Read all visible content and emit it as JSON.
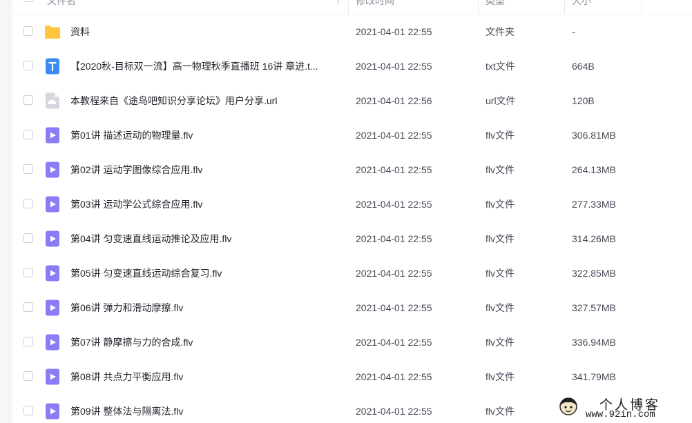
{
  "header": {
    "name": "文件名",
    "modified": "修改时间",
    "type": "类型",
    "size": "大小"
  },
  "icons": {
    "folder": "folder-icon",
    "txt": "text-file-icon",
    "url": "link-file-icon",
    "flv": "video-file-icon"
  },
  "colors": {
    "folder": "#ffc53d",
    "txt": "#3b8bf5",
    "url": "#d4d7dd",
    "flv": "#8b7cf6",
    "sort_arrow": "#3b7df0"
  },
  "rows": [
    {
      "icon": "folder",
      "name": "资料",
      "modified": "2021-04-01 22:55",
      "type": "文件夹",
      "size": "-"
    },
    {
      "icon": "txt",
      "name": "【2020秋-目标双一流】高一物理秋季直播班 16讲 章进.t...",
      "modified": "2021-04-01 22:55",
      "type": "txt文件",
      "size": "664B"
    },
    {
      "icon": "url",
      "name": "本教程来自《途鸟吧知识分享论坛》用户分享.url",
      "modified": "2021-04-01 22:56",
      "type": "url文件",
      "size": "120B"
    },
    {
      "icon": "flv",
      "name": "第01讲 描述运动的物理量.flv",
      "modified": "2021-04-01 22:55",
      "type": "flv文件",
      "size": "306.81MB"
    },
    {
      "icon": "flv",
      "name": "第02讲 运动学图像综合应用.flv",
      "modified": "2021-04-01 22:55",
      "type": "flv文件",
      "size": "264.13MB"
    },
    {
      "icon": "flv",
      "name": "第03讲 运动学公式综合应用.flv",
      "modified": "2021-04-01 22:55",
      "type": "flv文件",
      "size": "277.33MB"
    },
    {
      "icon": "flv",
      "name": "第04讲 匀变速直线运动推论及应用.flv",
      "modified": "2021-04-01 22:55",
      "type": "flv文件",
      "size": "314.26MB"
    },
    {
      "icon": "flv",
      "name": "第05讲 匀变速直线运动综合复习.flv",
      "modified": "2021-04-01 22:55",
      "type": "flv文件",
      "size": "322.85MB"
    },
    {
      "icon": "flv",
      "name": "第06讲 弹力和滑动摩擦.flv",
      "modified": "2021-04-01 22:55",
      "type": "flv文件",
      "size": "327.57MB"
    },
    {
      "icon": "flv",
      "name": "第07讲 静摩擦与力的合成.flv",
      "modified": "2021-04-01 22:55",
      "type": "flv文件",
      "size": "336.94MB"
    },
    {
      "icon": "flv",
      "name": "第08讲 共点力平衡应用.flv",
      "modified": "2021-04-01 22:55",
      "type": "flv文件",
      "size": "341.79MB"
    },
    {
      "icon": "flv",
      "name": "第09讲 整体法与隔离法.flv",
      "modified": "2021-04-01 22:55",
      "type": "flv文件",
      "size": ""
    }
  ],
  "watermark": {
    "title": "个人博客",
    "url": "www.92in.com"
  }
}
